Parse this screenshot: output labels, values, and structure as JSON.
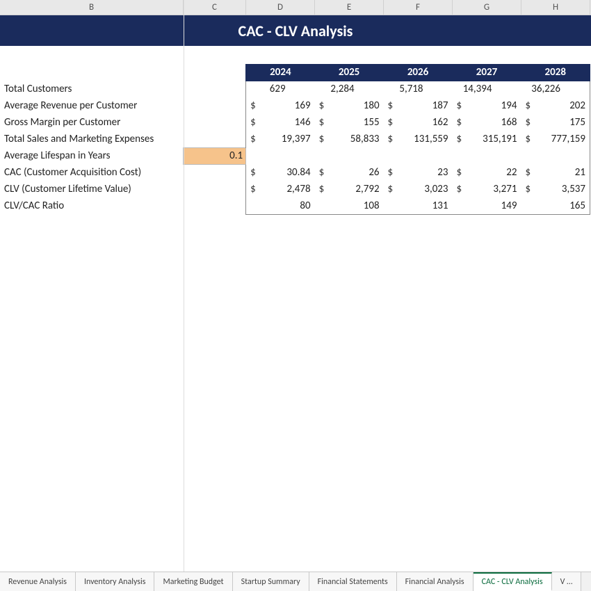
{
  "columns": {
    "B": "B",
    "C": "C",
    "D": "D",
    "E": "E",
    "F": "F",
    "G": "G",
    "H": "H"
  },
  "title": "CAC - CLV Analysis",
  "years": [
    "2024",
    "2025",
    "2026",
    "2027",
    "2028"
  ],
  "lifespan_input": "0.1",
  "rows": [
    {
      "label": "Total Customers",
      "type": "plain",
      "indent": true,
      "values": [
        "629",
        "2,284",
        "5,718",
        "14,394",
        "36,226"
      ]
    },
    {
      "label": "Average Revenue per Customer",
      "type": "money",
      "values": [
        "169",
        "180",
        "187",
        "194",
        "202"
      ]
    },
    {
      "label": "Gross Margin per Customer",
      "type": "money",
      "values": [
        "146",
        "155",
        "162",
        "168",
        "175"
      ]
    },
    {
      "label": "Total Sales and Marketing Expenses",
      "type": "money",
      "values": [
        "19,397",
        "58,833",
        "131,559",
        "315,191",
        "777,159"
      ]
    },
    {
      "label": "Average Lifespan in Years",
      "type": "empty",
      "values": [
        "",
        "",
        "",
        "",
        ""
      ]
    },
    {
      "label": "CAC (Customer Acquisition Cost)",
      "type": "money",
      "values": [
        "30.84",
        "26",
        "23",
        "22",
        "21"
      ]
    },
    {
      "label": "CLV (Customer Lifetime Value)",
      "type": "money",
      "values": [
        "2,478",
        "2,792",
        "3,023",
        "3,271",
        "3,537"
      ]
    },
    {
      "label": "CLV/CAC Ratio",
      "type": "plain",
      "indent": false,
      "values": [
        "80",
        "108",
        "131",
        "149",
        "165"
      ]
    }
  ],
  "tabs": [
    {
      "label": "Revenue Analysis",
      "active": false
    },
    {
      "label": "Inventory Analysis",
      "active": false
    },
    {
      "label": "Marketing Budget",
      "active": false
    },
    {
      "label": "Startup Summary",
      "active": false
    },
    {
      "label": "Financial Statements",
      "active": false
    },
    {
      "label": "Financial Analysis",
      "active": false
    },
    {
      "label": "CAC - CLV Analysis",
      "active": true
    },
    {
      "label": "V …",
      "active": false
    }
  ]
}
